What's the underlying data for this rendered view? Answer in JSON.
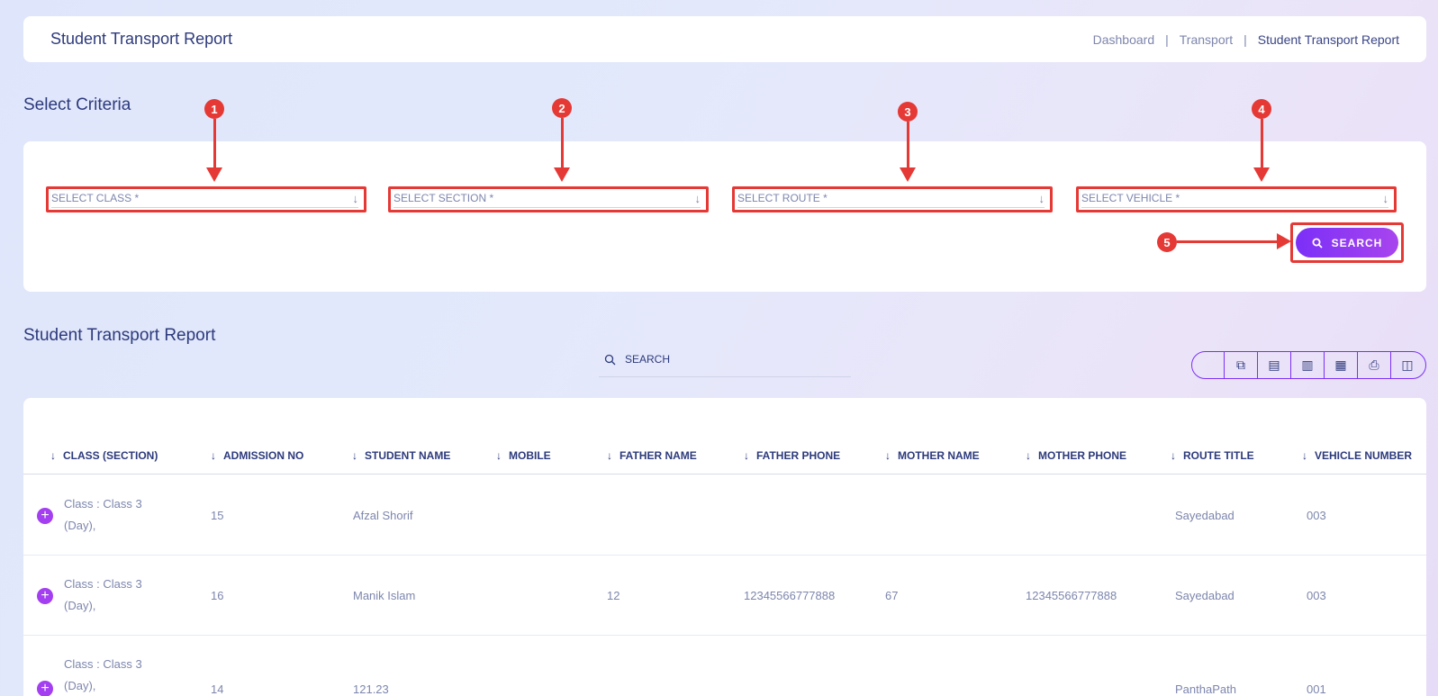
{
  "header": {
    "title": "Student Transport Report",
    "breadcrumb": [
      "Dashboard",
      "Transport",
      "Student Transport Report"
    ]
  },
  "criteria": {
    "title": "Select Criteria",
    "selects": [
      {
        "placeholder": "SELECT CLASS *",
        "marker": "1"
      },
      {
        "placeholder": "SELECT SECTION *",
        "marker": "2"
      },
      {
        "placeholder": "SELECT ROUTE *",
        "marker": "3"
      },
      {
        "placeholder": "SELECT VEHICLE *",
        "marker": "4"
      }
    ],
    "search_marker": "5",
    "search_label": "SEARCH"
  },
  "report": {
    "title": "Student Transport Report",
    "search_placeholder": "SEARCH",
    "toolbar_icons": [
      "copy-icon",
      "excel-icon",
      "csv-icon",
      "pdf-icon",
      "print-icon",
      "columns-icon"
    ],
    "columns": [
      "CLASS (SECTION)",
      "ADMISSION NO",
      "STUDENT NAME",
      "MOBILE",
      "FATHER NAME",
      "FATHER PHONE",
      "MOTHER NAME",
      "MOTHER PHONE",
      "ROUTE TITLE",
      "VEHICLE NUMBER"
    ],
    "rows": [
      {
        "class_section": "Class : Class 3 (Day),",
        "admission_no": "15",
        "student_name": "Afzal Shorif",
        "mobile": "",
        "father_name": "",
        "father_phone": "",
        "mother_name": "",
        "mother_phone": "",
        "route_title": "Sayedabad",
        "vehicle_number": "003"
      },
      {
        "class_section": "Class : Class 3 (Day),",
        "admission_no": "16",
        "student_name": "Manik Islam",
        "mobile": "",
        "father_name": "12",
        "father_phone": "12345566777888",
        "mother_name": "67",
        "mother_phone": "12345566777888",
        "route_title": "Sayedabad",
        "vehicle_number": "003"
      },
      {
        "class_section": "Class : Class 3 (Day),",
        "admission_no": "14",
        "student_name": "121.23",
        "mobile": "",
        "father_name": "",
        "father_phone": "",
        "mother_name": "",
        "mother_phone": "",
        "route_title": "PanthaPath",
        "vehicle_number": "001"
      }
    ]
  }
}
